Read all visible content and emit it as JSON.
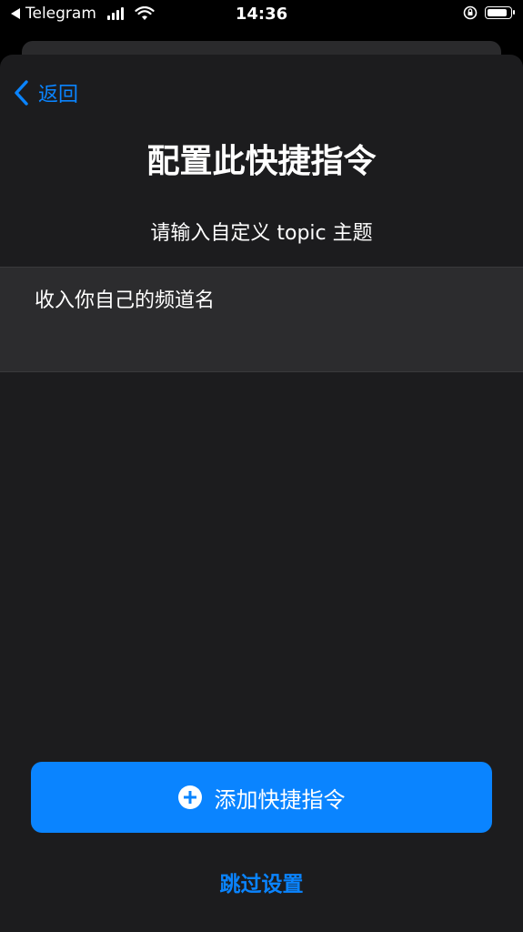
{
  "status_bar": {
    "back_app": "Telegram",
    "time": "14:36",
    "battery_level": 0.9
  },
  "nav": {
    "back_label": "返回"
  },
  "page": {
    "title": "配置此快捷指令",
    "subtitle": "请输入自定义 topic 主题",
    "input_value": "收入你自己的频道名"
  },
  "actions": {
    "primary_label": "添加快捷指令",
    "skip_label": "跳过设置"
  },
  "colors": {
    "accent": "#0a84ff",
    "sheet_bg": "#1c1c1e",
    "input_bg": "#2c2c2e"
  },
  "icons": {
    "back": "chevron-left-icon",
    "add": "plus-circle-icon"
  }
}
